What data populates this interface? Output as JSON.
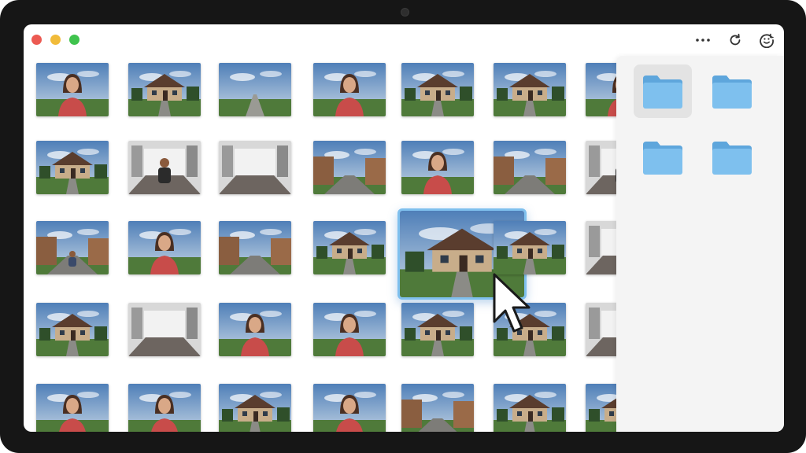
{
  "window": {
    "controls": [
      "close",
      "minimize",
      "maximize"
    ],
    "toolbar": [
      {
        "name": "more-options-icon",
        "icon": "ellipsis"
      },
      {
        "name": "refresh-icon",
        "icon": "rotate-clockwise"
      },
      {
        "name": "account-icon",
        "icon": "smiley-face"
      }
    ]
  },
  "colors": {
    "close": "#ec5a52",
    "minimize": "#f1bb3a",
    "maximize": "#3fc34d",
    "selection_border": "#7fc0ee",
    "folder": "#7ec0ee",
    "folder_tab": "#5ea6dc",
    "sidebar_bg": "#f4f4f4"
  },
  "photos": [
    [
      "portrait",
      "house",
      "road",
      "portrait",
      "house",
      "house",
      "portrait"
    ],
    [
      "house",
      "interior-portrait",
      "interior",
      "street",
      "portrait",
      "street",
      "interior-portrait"
    ],
    [
      "street-portrait",
      "portrait",
      "street",
      "house",
      "house",
      "house",
      "interior"
    ],
    [
      "house",
      "interior",
      "portrait",
      "portrait",
      "house",
      "house",
      "interior"
    ],
    [
      "portrait",
      "portrait",
      "house",
      "portrait",
      "street",
      "house",
      "house"
    ]
  ],
  "selected_photo": {
    "row": 2,
    "col": 4,
    "subject": "house"
  },
  "sidebar": {
    "folders": [
      {
        "name": "folder-1",
        "active": true
      },
      {
        "name": "folder-2",
        "active": false
      },
      {
        "name": "folder-3",
        "active": false
      },
      {
        "name": "folder-4",
        "active": false
      }
    ]
  }
}
